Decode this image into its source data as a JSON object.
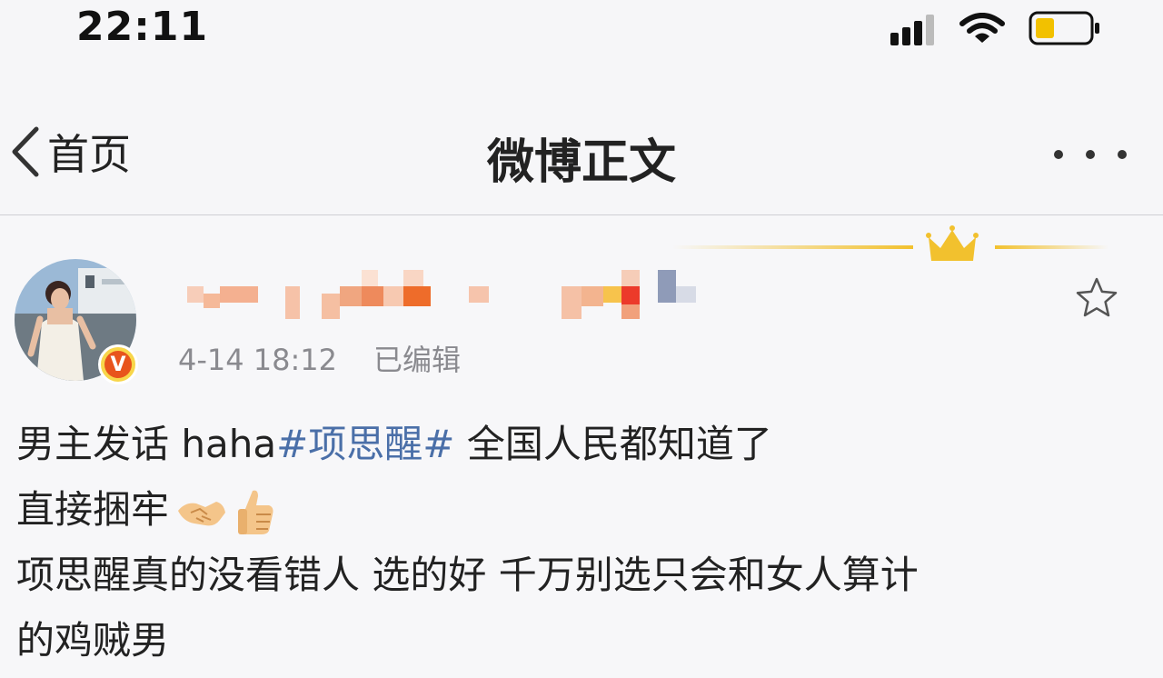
{
  "status_bar": {
    "time": "22:11"
  },
  "nav": {
    "back_label": "首页",
    "title": "微博正文"
  },
  "post": {
    "date": "4-14 18:12",
    "edited_label": "已编辑",
    "verified_badge": "V",
    "line1_prefix": "男主发话 haha",
    "hashtag": "#项思醒#",
    "line1_suffix": " 全国人民都知道了",
    "line2": "直接捆牢",
    "line3": "项思醒真的没看错人 选的好 千万别选只会和女人算计",
    "line4": "的鸡贼男",
    "emojis": [
      "handshake-emoji",
      "thumbs-up-emoji"
    ]
  },
  "colors": {
    "hashtag": "#4a6fa8",
    "crown": "#f2c12e",
    "verified_bg": "#e8541c",
    "meta_text": "#8a8a8f"
  }
}
